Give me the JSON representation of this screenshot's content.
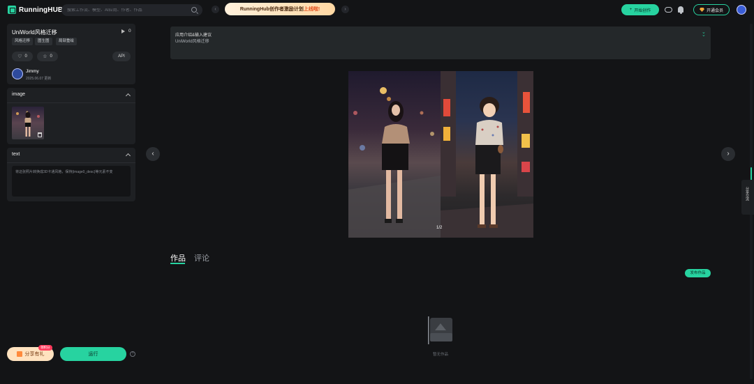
{
  "header": {
    "logo_text": "RunningHUB",
    "search_placeholder": "搜索工作流、模型、AI应用、作者、作品",
    "promo_part1": "RunningHub创作者激励计划",
    "promo_part2": "上线啦!",
    "start_label": "开始创作",
    "vip_label": "开通会员"
  },
  "info": {
    "title": "UniWorld风格迁移",
    "play_count": "0",
    "tags": [
      "风格迁移",
      "图生图",
      "局部重绘"
    ],
    "likes": "0",
    "favorites": "0",
    "api_label": "API",
    "author_name": "Jimmy",
    "author_date": "2025.06.07 更新"
  },
  "image_section": {
    "label": "image"
  },
  "text_section": {
    "label": "text",
    "value": "将这张照片转换成3D卡通风格，保持{image0_desc}等元素不变"
  },
  "actions": {
    "share_label": "分享有礼",
    "share_badge": "领积分",
    "run_label": "运行",
    "help": "?"
  },
  "intro": {
    "heading": "应用介绍&输入建议",
    "subtitle": "UniWorld风格迁移"
  },
  "gallery": {
    "counter": "1/2"
  },
  "tabs": {
    "works": "作品",
    "comments": "评论"
  },
  "publish_label": "发布作品",
  "empty_text": "暂无作品",
  "right_tab_label": "分享交流",
  "icons": [
    "search-icon",
    "gamepad-icon",
    "bell-icon",
    "gem-icon",
    "play-icon",
    "heart-icon",
    "star-icon",
    "trash-icon",
    "gift-icon",
    "help-icon"
  ],
  "colors": {
    "accent": "#27d3a0",
    "background": "#131416",
    "panel": "#1e2023"
  }
}
